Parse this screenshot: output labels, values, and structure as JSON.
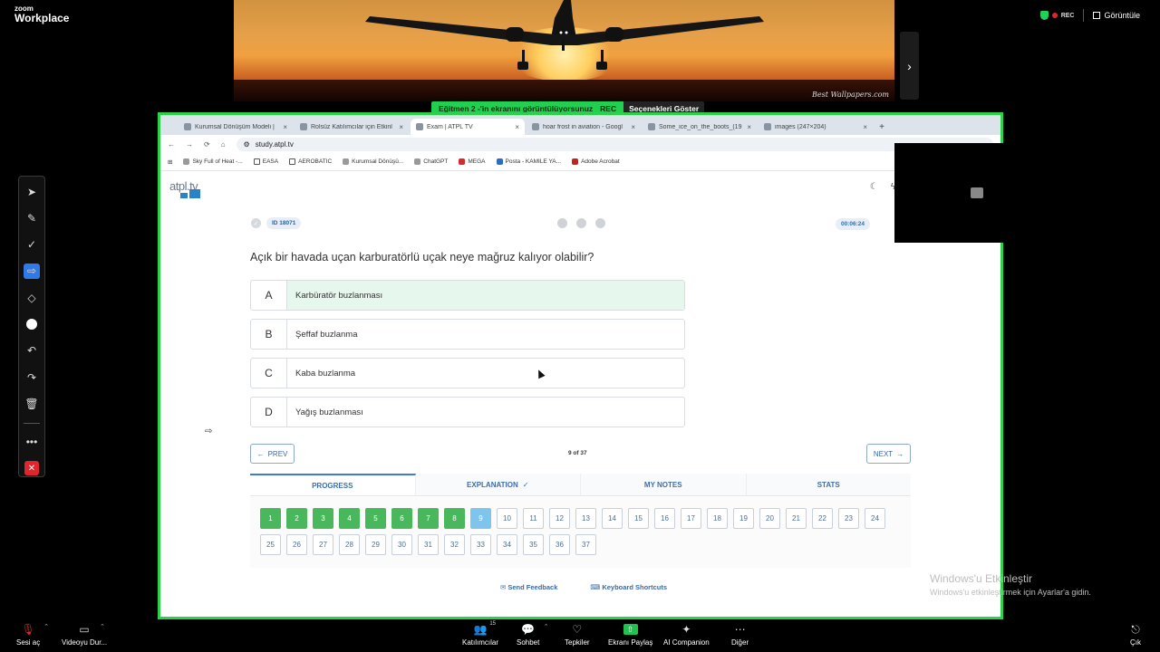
{
  "zoom": {
    "logo_line1": "zoom",
    "logo_line2": "Workplace",
    "rec_label": "REC",
    "view_label": "Görüntüle",
    "watermark": "Best Wallpapers.com"
  },
  "share_banner": {
    "message": "Eğitmen 2 -'in ekranını görüntülüyorsunuz",
    "rec": "REC",
    "options": "Seçenekleri Göster"
  },
  "browser": {
    "tabs": [
      {
        "label": "Kurumsal Dönüşüm Modeli |"
      },
      {
        "label": "Rolsüz Katılımcılar için Etkinl"
      },
      {
        "label": "Exam | ATPL TV",
        "active": true
      },
      {
        "label": "hoar frost in aviation - Googl"
      },
      {
        "label": "Some_ice_on_the_boots_(19"
      },
      {
        "label": "images (247×204)"
      }
    ],
    "url": "study.atpl.tv",
    "bookmarks": [
      "Sky Full of Heat -...",
      "EASA",
      "AEROBATIC",
      "Kurumsal Dönüşü...",
      "ChatGPT",
      "MEGA",
      "Posta - KAMILE YA...",
      "Adobe Acrobat"
    ]
  },
  "exam": {
    "logo": "atpl.tv",
    "id_label": "ID 18071",
    "timer": "00:06:24",
    "question": "Açık bir havada uçan karburatörlü uçak neye mağruz kalıyor olabilir?",
    "options": [
      {
        "letter": "A",
        "text": "Karbüratör buzlanması",
        "selected": true
      },
      {
        "letter": "B",
        "text": "Şeffaf buzlanma"
      },
      {
        "letter": "C",
        "text": "Kaba buzlanma"
      },
      {
        "letter": "D",
        "text": "Yağış buzlanması"
      }
    ],
    "prev": "PREV",
    "next": "NEXT",
    "page_count": "9 of 37",
    "tabs": [
      "PROGRESS",
      "EXPLANATION",
      "MY NOTES",
      "STATS"
    ],
    "questions_total": 37,
    "answered_count": 8,
    "current_question": 9,
    "footer": {
      "feedback": "Send Feedback",
      "shortcuts": "Keyboard Shortcuts"
    }
  },
  "windows": {
    "activate_title": "Windows'u Etkinleştir",
    "activate_sub": "Windows'u etkinleştirmek için Ayarlar'a gidin."
  },
  "toolbar": {
    "mute": "Sesi aç",
    "video": "Videoyu Dur...",
    "participants": "Katılımcılar",
    "participants_count": "15",
    "chat": "Sohbet",
    "reactions": "Tepkiler",
    "share": "Ekranı Paylaş",
    "ai": "AI Companion",
    "more": "Diğer",
    "leave": "Çık"
  }
}
